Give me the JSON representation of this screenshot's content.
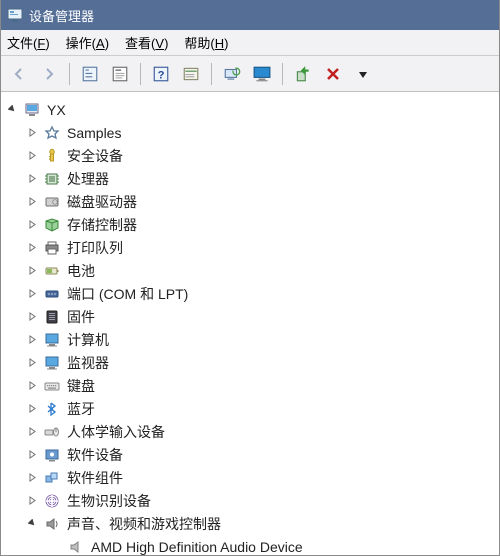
{
  "window": {
    "title": "设备管理器"
  },
  "menubar": {
    "file": {
      "label": "文件",
      "accel": "F"
    },
    "action": {
      "label": "操作",
      "accel": "A"
    },
    "view": {
      "label": "查看",
      "accel": "V"
    },
    "help": {
      "label": "帮助",
      "accel": "H"
    }
  },
  "toolbar": {
    "back": "后退",
    "forward": "前进",
    "show_hide": "显示/隐藏控制台树",
    "properties": "属性",
    "help": "帮助",
    "action_list": "操作列表",
    "scan": "扫描检测硬件改动",
    "update_driver": "更新驱动程序",
    "uninstall": "卸载设备",
    "disable": "禁用设备",
    "add_legacy": "添加过时硬件"
  },
  "tree": {
    "root": {
      "label": "YX"
    },
    "categories": [
      {
        "key": "samples",
        "label": "Samples"
      },
      {
        "key": "security",
        "label": "安全设备"
      },
      {
        "key": "cpu",
        "label": "处理器"
      },
      {
        "key": "disk",
        "label": "磁盘驱动器"
      },
      {
        "key": "storage",
        "label": "存储控制器"
      },
      {
        "key": "print",
        "label": "打印队列"
      },
      {
        "key": "battery",
        "label": "电池"
      },
      {
        "key": "ports",
        "label": "端口 (COM 和 LPT)"
      },
      {
        "key": "firmware",
        "label": "固件"
      },
      {
        "key": "computer",
        "label": "计算机"
      },
      {
        "key": "monitor",
        "label": "监视器"
      },
      {
        "key": "keyboard",
        "label": "键盘"
      },
      {
        "key": "bluetooth",
        "label": "蓝牙"
      },
      {
        "key": "hid",
        "label": "人体学输入设备"
      },
      {
        "key": "softdev",
        "label": "软件设备"
      },
      {
        "key": "softcomp",
        "label": "软件组件"
      },
      {
        "key": "biometric",
        "label": "生物识别设备"
      },
      {
        "key": "sound",
        "label": "声音、视频和游戏控制器"
      }
    ],
    "sound_children": [
      {
        "key": "amd-hd-audio",
        "label": "AMD High Definition Audio Device"
      }
    ]
  }
}
